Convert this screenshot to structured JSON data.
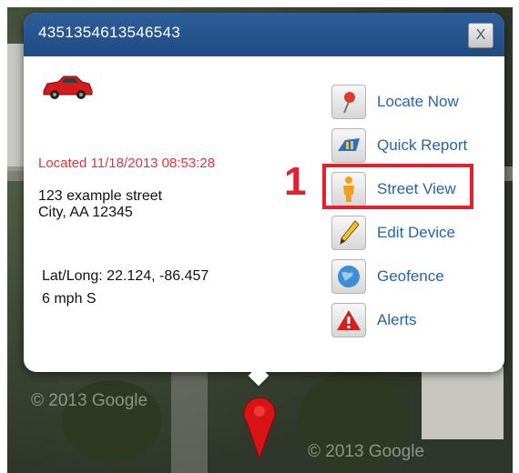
{
  "popup": {
    "title": "4351354613546543",
    "close_label": "X",
    "located": "Located 11/18/2013 08:53:28",
    "address_line1": "123 example street",
    "address_line2": "City, AA 12345",
    "latlong": "Lat/Long: 22.124, -86.457",
    "speed": "6 mph S"
  },
  "menu": {
    "items": [
      {
        "label": "Locate Now",
        "icon": "pin-icon"
      },
      {
        "label": "Quick Report",
        "icon": "report-icon"
      },
      {
        "label": "Street View",
        "icon": "person-icon"
      },
      {
        "label": "Edit Device",
        "icon": "pencil-icon"
      },
      {
        "label": "Geofence",
        "icon": "globe-icon"
      },
      {
        "label": "Alerts",
        "icon": "warning-icon"
      }
    ]
  },
  "annotation": {
    "step": "1",
    "color": "#e3202b"
  },
  "map": {
    "copyright": "© 2013 Google"
  },
  "colors": {
    "header": "#1f4b82",
    "link": "#2a62a8",
    "located": "#e8323a"
  }
}
